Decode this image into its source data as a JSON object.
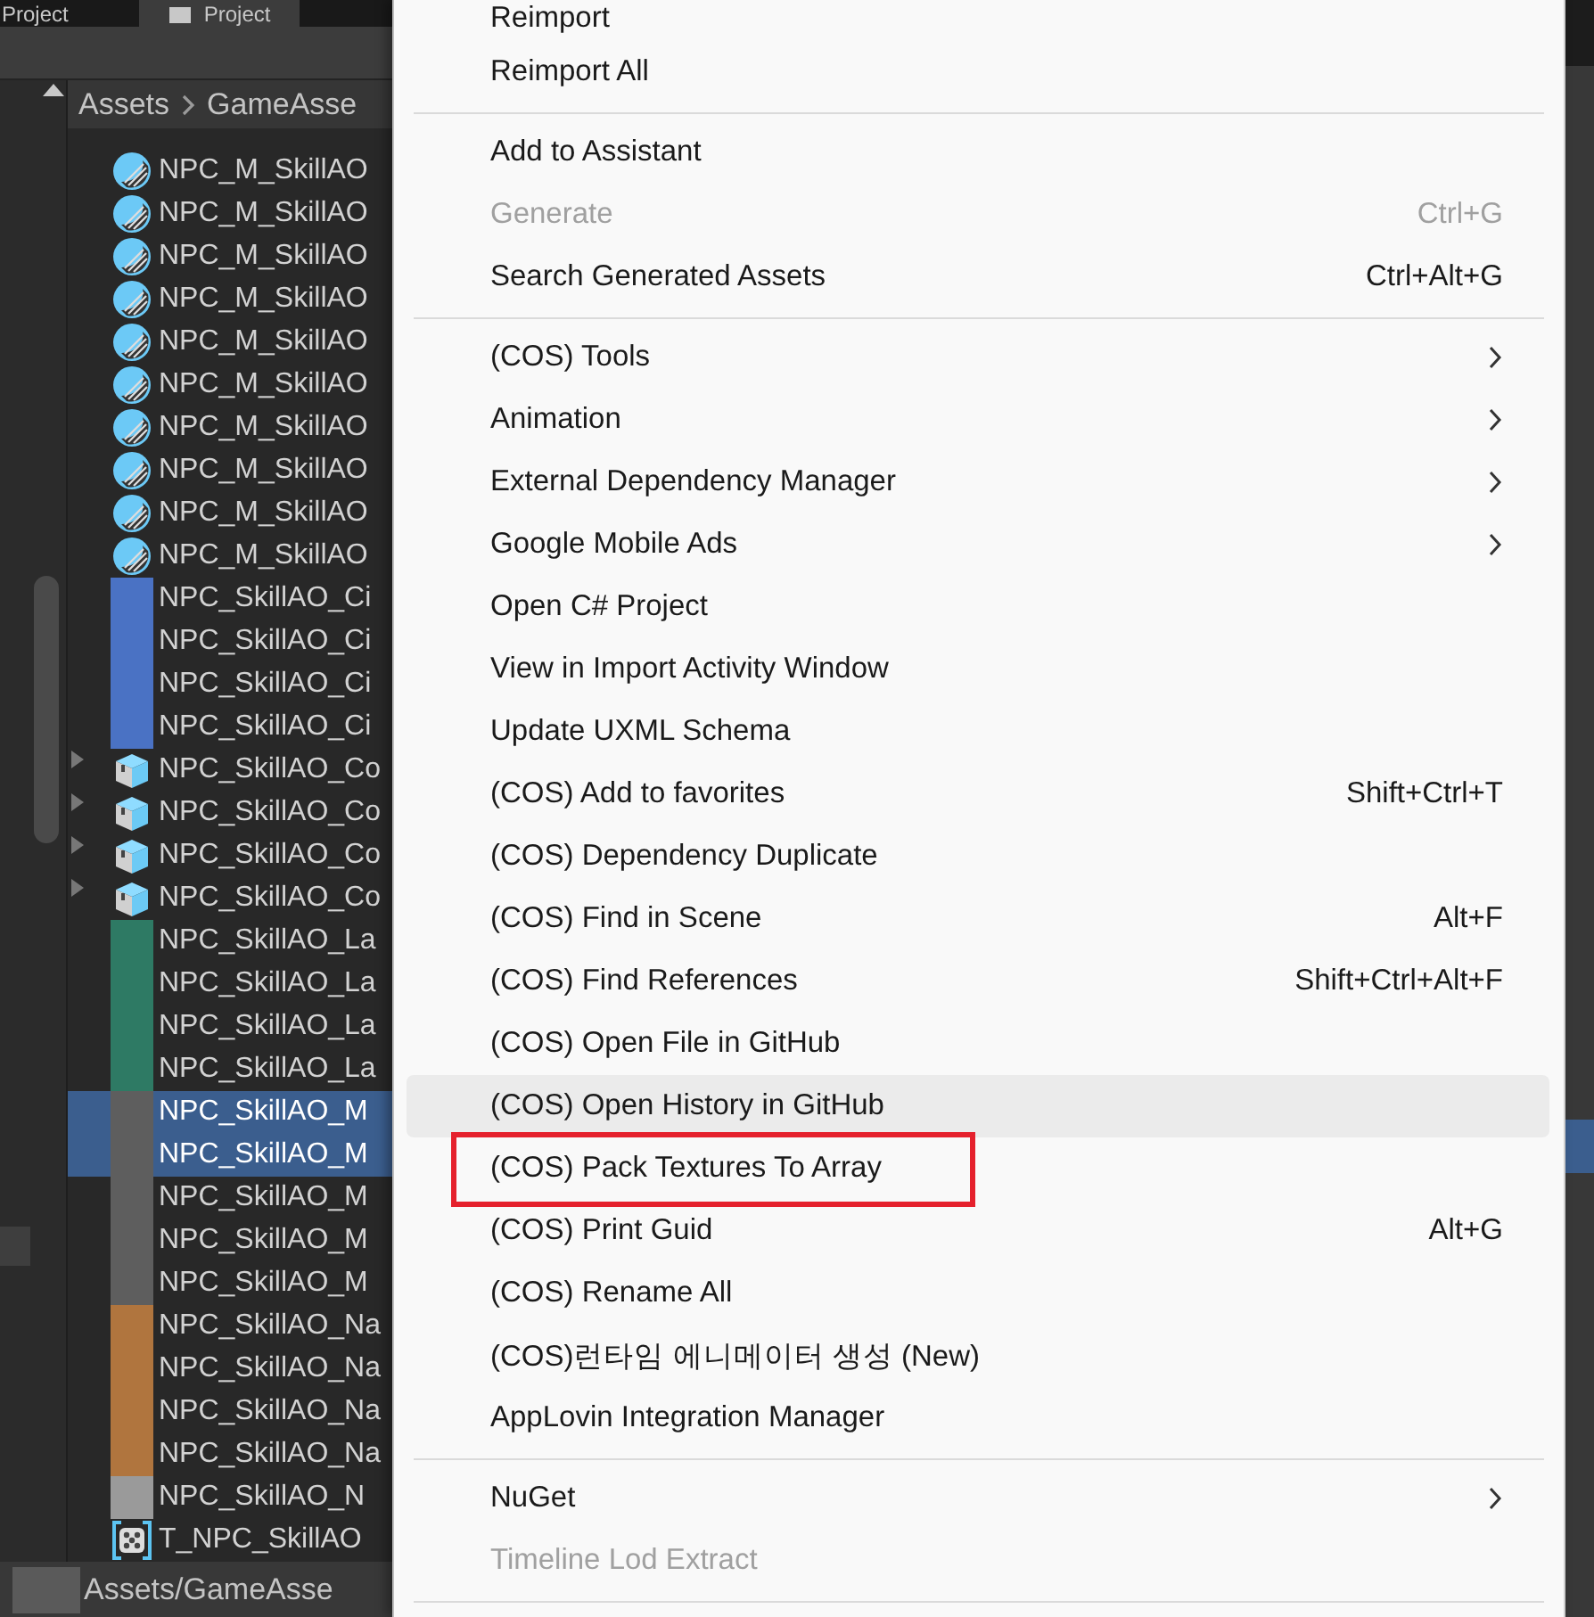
{
  "project_panel": {
    "tabs": [
      {
        "label": "Project",
        "selected": false
      },
      {
        "label": "Project",
        "selected": true
      }
    ],
    "breadcrumb": [
      "Assets",
      "GameAsse"
    ],
    "rows": [
      {
        "name": "NPC_M_SkillAO",
        "kind": "material",
        "selected": false
      },
      {
        "name": "NPC_M_SkillAO",
        "kind": "material",
        "selected": false
      },
      {
        "name": "NPC_M_SkillAO",
        "kind": "material",
        "selected": false
      },
      {
        "name": "NPC_M_SkillAO",
        "kind": "material",
        "selected": false
      },
      {
        "name": "NPC_M_SkillAO",
        "kind": "material",
        "selected": false
      },
      {
        "name": "NPC_M_SkillAO",
        "kind": "material",
        "selected": false
      },
      {
        "name": "NPC_M_SkillAO",
        "kind": "material",
        "selected": false
      },
      {
        "name": "NPC_M_SkillAO",
        "kind": "material",
        "selected": false
      },
      {
        "name": "NPC_M_SkillAO",
        "kind": "material",
        "selected": false
      },
      {
        "name": "NPC_M_SkillAO",
        "kind": "material",
        "selected": false
      },
      {
        "name": "NPC_SkillAO_Ci",
        "kind": "texture",
        "color": "#4a72c4",
        "selected": false
      },
      {
        "name": "NPC_SkillAO_Ci",
        "kind": "texture",
        "color": "#4a72c4",
        "selected": false
      },
      {
        "name": "NPC_SkillAO_Ci",
        "kind": "texture",
        "color": "#4a72c4",
        "selected": false
      },
      {
        "name": "NPC_SkillAO_Ci",
        "kind": "texture",
        "color": "#4a72c4",
        "selected": false
      },
      {
        "name": "NPC_SkillAO_Co",
        "kind": "prefab",
        "expanded": false,
        "selected": false
      },
      {
        "name": "NPC_SkillAO_Co",
        "kind": "prefab",
        "expanded": false,
        "selected": false
      },
      {
        "name": "NPC_SkillAO_Co",
        "kind": "prefab",
        "expanded": false,
        "selected": false
      },
      {
        "name": "NPC_SkillAO_Co",
        "kind": "prefab",
        "expanded": false,
        "selected": false
      },
      {
        "name": "NPC_SkillAO_La",
        "kind": "texture",
        "color": "#2e7a64",
        "selected": false
      },
      {
        "name": "NPC_SkillAO_La",
        "kind": "texture",
        "color": "#2e7a64",
        "selected": false
      },
      {
        "name": "NPC_SkillAO_La",
        "kind": "texture",
        "color": "#2e7a64",
        "selected": false
      },
      {
        "name": "NPC_SkillAO_La",
        "kind": "texture",
        "color": "#2e7a64",
        "selected": false
      },
      {
        "name": "NPC_SkillAO_M",
        "kind": "texture",
        "color": "#5e5e5e",
        "selected": true
      },
      {
        "name": "NPC_SkillAO_M",
        "kind": "texture",
        "color": "#5e5e5e",
        "selected": true
      },
      {
        "name": "NPC_SkillAO_M",
        "kind": "texture",
        "color": "#5e5e5e",
        "selected": false
      },
      {
        "name": "NPC_SkillAO_M",
        "kind": "texture",
        "color": "#5e5e5e",
        "selected": false
      },
      {
        "name": "NPC_SkillAO_M",
        "kind": "texture",
        "color": "#5e5e5e",
        "selected": false
      },
      {
        "name": "NPC_SkillAO_Na",
        "kind": "texture",
        "color": "#b0753e",
        "selected": false
      },
      {
        "name": "NPC_SkillAO_Na",
        "kind": "texture",
        "color": "#b0753e",
        "selected": false
      },
      {
        "name": "NPC_SkillAO_Na",
        "kind": "texture",
        "color": "#b0753e",
        "selected": false
      },
      {
        "name": "NPC_SkillAO_Na",
        "kind": "texture",
        "color": "#b0753e",
        "selected": false
      },
      {
        "name": "NPC_SkillAO_N",
        "kind": "texture",
        "color": "#9a9a9a",
        "selected": false
      },
      {
        "name": "T_NPC_SkillAO",
        "kind": "texture-array",
        "selected": false
      }
    ],
    "footer_path": "Assets/GameAsse"
  },
  "context_menu": {
    "items": [
      {
        "kind": "item",
        "label": "Reimport",
        "disabled": false,
        "highlighted": false,
        "submenu": false,
        "annotated": false
      },
      {
        "kind": "item",
        "label": "Reimport All",
        "disabled": false,
        "highlighted": false,
        "submenu": false,
        "annotated": false
      },
      {
        "kind": "separator"
      },
      {
        "kind": "item",
        "label": "Add to Assistant",
        "disabled": false,
        "highlighted": false,
        "submenu": false,
        "annotated": false
      },
      {
        "kind": "item",
        "label": "Generate",
        "shortcut": "Ctrl+G",
        "disabled": true,
        "highlighted": false,
        "submenu": false,
        "annotated": false
      },
      {
        "kind": "item",
        "label": "Search Generated Assets",
        "shortcut": "Ctrl+Alt+G",
        "disabled": false,
        "highlighted": false,
        "submenu": false,
        "annotated": false
      },
      {
        "kind": "separator"
      },
      {
        "kind": "item",
        "label": "(COS) Tools",
        "disabled": false,
        "highlighted": false,
        "submenu": true,
        "annotated": false
      },
      {
        "kind": "item",
        "label": "Animation",
        "disabled": false,
        "highlighted": false,
        "submenu": true,
        "annotated": false
      },
      {
        "kind": "item",
        "label": "External Dependency Manager",
        "disabled": false,
        "highlighted": false,
        "submenu": true,
        "annotated": false
      },
      {
        "kind": "item",
        "label": "Google Mobile Ads",
        "disabled": false,
        "highlighted": false,
        "submenu": true,
        "annotated": false
      },
      {
        "kind": "item",
        "label": "Open C# Project",
        "disabled": false,
        "highlighted": false,
        "submenu": false,
        "annotated": false
      },
      {
        "kind": "item",
        "label": "View in Import Activity Window",
        "disabled": false,
        "highlighted": false,
        "submenu": false,
        "annotated": false
      },
      {
        "kind": "item",
        "label": "Update UXML Schema",
        "disabled": false,
        "highlighted": false,
        "submenu": false,
        "annotated": false
      },
      {
        "kind": "item",
        "label": "(COS) Add to favorites",
        "shortcut": "Shift+Ctrl+T",
        "disabled": false,
        "highlighted": false,
        "submenu": false,
        "annotated": false
      },
      {
        "kind": "item",
        "label": "(COS) Dependency Duplicate",
        "disabled": false,
        "highlighted": false,
        "submenu": false,
        "annotated": false
      },
      {
        "kind": "item",
        "label": "(COS) Find in Scene",
        "shortcut": "Alt+F",
        "disabled": false,
        "highlighted": false,
        "submenu": false,
        "annotated": false
      },
      {
        "kind": "item",
        "label": "(COS) Find References",
        "shortcut": "Shift+Ctrl+Alt+F",
        "disabled": false,
        "highlighted": false,
        "submenu": false,
        "annotated": false
      },
      {
        "kind": "item",
        "label": "(COS) Open File in GitHub",
        "disabled": false,
        "highlighted": false,
        "submenu": false,
        "annotated": false
      },
      {
        "kind": "item",
        "label": "(COS) Open History in GitHub",
        "disabled": false,
        "highlighted": true,
        "submenu": false,
        "annotated": false
      },
      {
        "kind": "item",
        "label": "(COS) Pack Textures To Array",
        "disabled": false,
        "highlighted": false,
        "submenu": false,
        "annotated": true
      },
      {
        "kind": "item",
        "label": "(COS) Print Guid",
        "shortcut": "Alt+G",
        "disabled": false,
        "highlighted": false,
        "submenu": false,
        "annotated": false
      },
      {
        "kind": "item",
        "label": "(COS) Rename All",
        "disabled": false,
        "highlighted": false,
        "submenu": false,
        "annotated": false
      },
      {
        "kind": "item",
        "label": "(COS)런타임 에니메이터 생성 (New)",
        "disabled": false,
        "highlighted": false,
        "submenu": false,
        "annotated": false
      },
      {
        "kind": "item",
        "label": "AppLovin Integration Manager",
        "disabled": false,
        "highlighted": false,
        "submenu": false,
        "annotated": false
      },
      {
        "kind": "separator"
      },
      {
        "kind": "item",
        "label": "NuGet",
        "disabled": false,
        "highlighted": false,
        "submenu": true,
        "annotated": false
      },
      {
        "kind": "item",
        "label": "Timeline Lod Extract",
        "disabled": true,
        "highlighted": false,
        "submenu": false,
        "annotated": false
      },
      {
        "kind": "separator"
      }
    ]
  }
}
